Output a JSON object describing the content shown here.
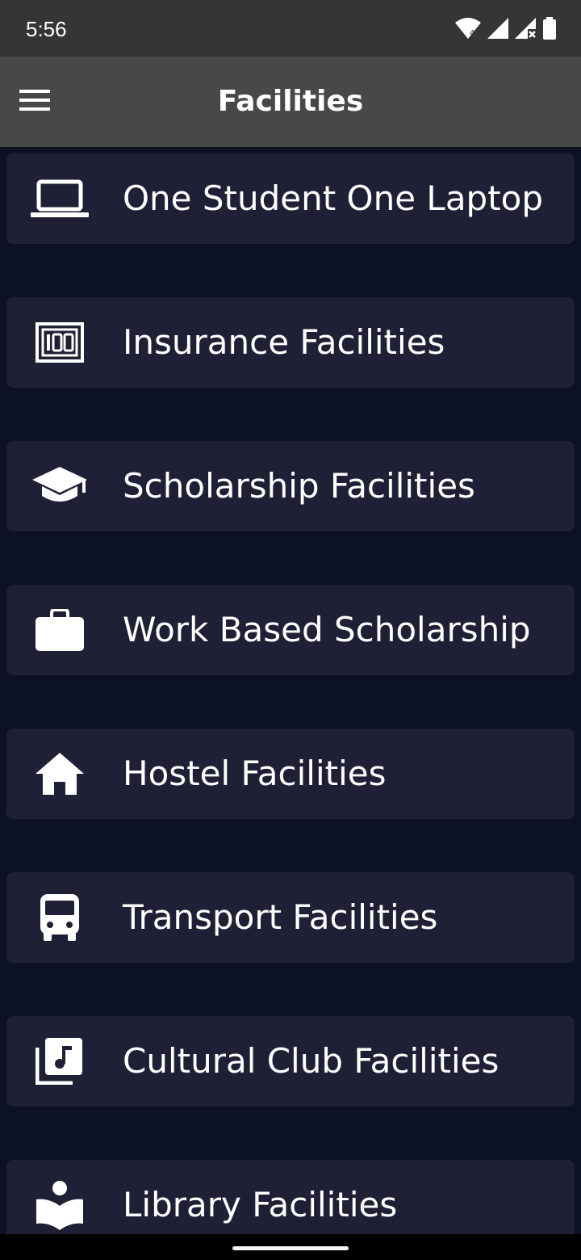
{
  "status_bar": {
    "time": "5:56",
    "icons": [
      "wifi-icon",
      "signal-icon",
      "signal-no-data-icon",
      "battery-icon"
    ]
  },
  "app_bar": {
    "title": "Facilities",
    "menu_icon": "hamburger-menu-icon"
  },
  "facilities": [
    {
      "label": "One Student One Laptop",
      "icon": "laptop-icon"
    },
    {
      "label": "Insurance Facilities",
      "icon": "insurance-100-icon"
    },
    {
      "label": "Scholarship Facilities",
      "icon": "graduation-cap-icon"
    },
    {
      "label": "Work Based Scholarship",
      "icon": "briefcase-icon"
    },
    {
      "label": "Hostel Facilities",
      "icon": "home-icon"
    },
    {
      "label": "Transport Facilities",
      "icon": "bus-icon"
    },
    {
      "label": "Cultural Club Facilities",
      "icon": "music-library-icon"
    },
    {
      "label": "Library Facilities",
      "icon": "reading-book-icon"
    }
  ],
  "colors": {
    "background": "#0c1124",
    "card": "#1f2035",
    "app_bar": "#484848",
    "status_bar": "#353535",
    "text": "#ffffff"
  }
}
